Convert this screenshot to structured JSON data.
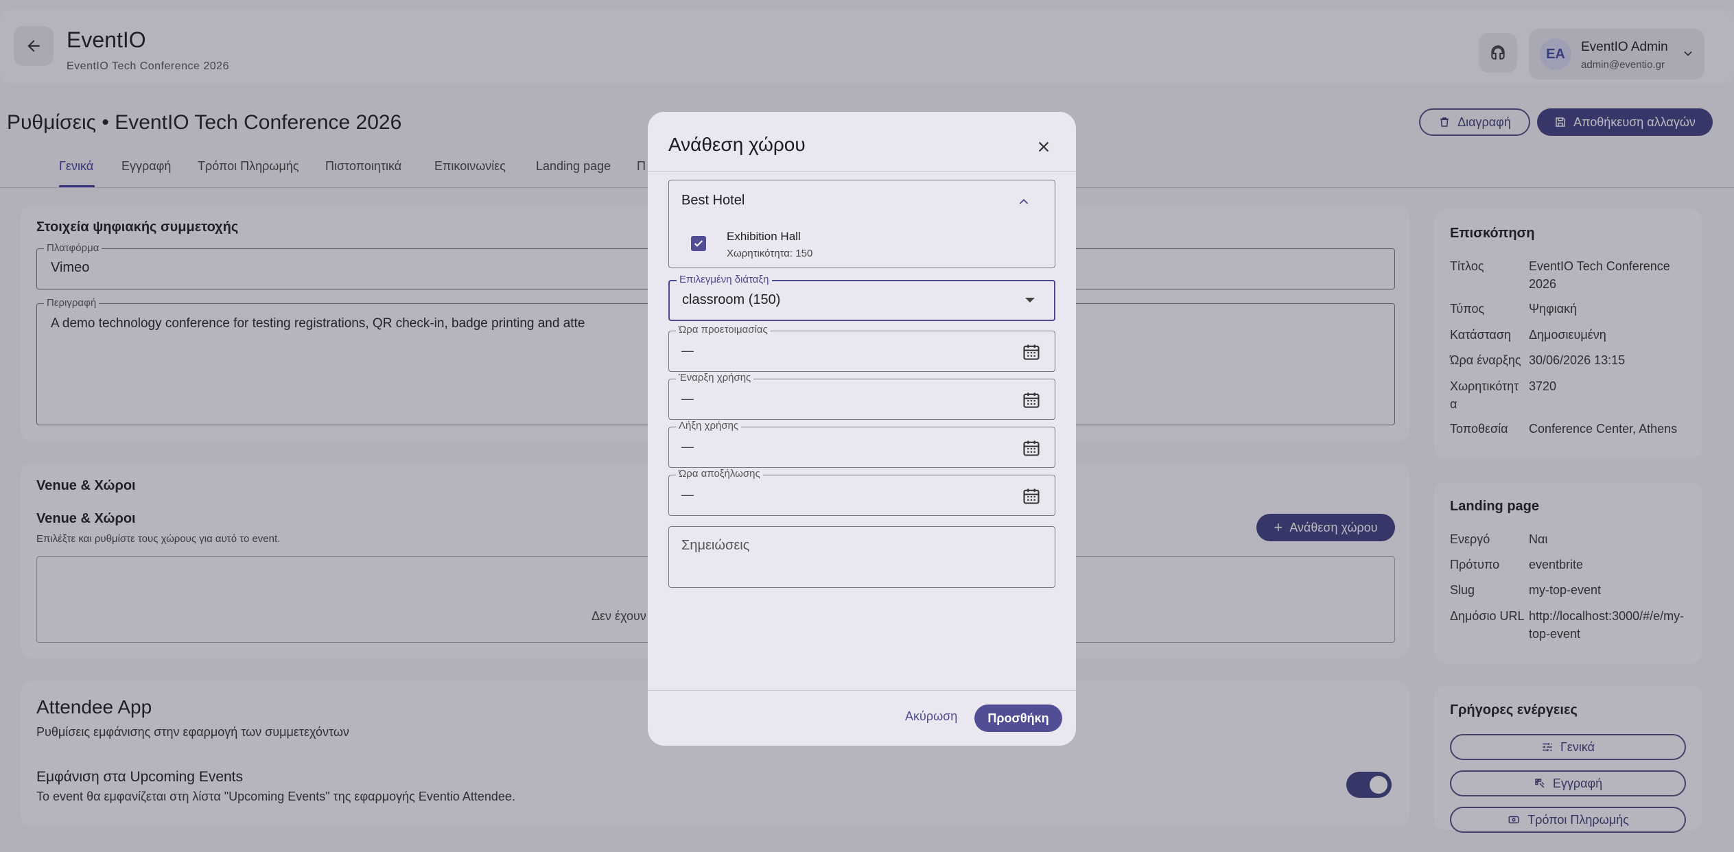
{
  "header": {
    "title": "EventIO",
    "subtitle": "EventIO Tech Conference 2026",
    "user": {
      "initials": "EA",
      "name": "EventIO Admin",
      "email": "admin@eventio.gr"
    }
  },
  "page": {
    "title": "Ρυθμίσεις • EventIO Tech Conference 2026",
    "delete_label": "Διαγραφή",
    "save_label": "Αποθήκευση αλλαγών"
  },
  "tabs": [
    {
      "label": "Γενικά"
    },
    {
      "label": "Εγγραφή"
    },
    {
      "label": "Τρόποι Πληρωμής"
    },
    {
      "label": "Πιστοποιητικά"
    },
    {
      "label": "Επικοινωνίες"
    },
    {
      "label": "Landing page"
    },
    {
      "label": "Π"
    }
  ],
  "digital": {
    "title": "Στοιχεία ψηφιακής συμμετοχής",
    "platform_label": "Πλατφόρμα",
    "platform_value": "Vimeo",
    "desc_label": "Περιγραφή",
    "desc_value": "A demo technology conference for testing registrations, QR check-in, badge printing and atte"
  },
  "venue": {
    "section_title": "Venue & Χώροι",
    "sub_title": "Venue & Χώροι",
    "hint": "Επιλέξτε και ρυθμίστε τους χώρους για αυτό το event.",
    "assign_label": "Ανάθεση χώρου",
    "empty_text": "Δεν έχουν"
  },
  "attendee_app": {
    "title": "Attendee App",
    "subtitle": "Ρυθμίσεις εμφάνισης στην εφαρμογή των συμμετεχόντων",
    "upcoming_title": "Εμφάνιση στα Upcoming Events",
    "upcoming_desc": "Το event θα εμφανίζεται στη λίστα \"Upcoming Events\" της εφαρμογής Eventio Attendee.",
    "upcoming_enabled": true
  },
  "overview": {
    "title": "Επισκόπηση",
    "rows": [
      {
        "k": "Τίτλος",
        "v": "EventIO Tech Conference 2026"
      },
      {
        "k": "Τύπος",
        "v": "Ψηφιακή"
      },
      {
        "k": "Κατάσταση",
        "v": "Δημοσιευμένη"
      },
      {
        "k": "Ώρα έναρξης",
        "v": "30/06/2026 13:15"
      },
      {
        "k": "Χωρητικότητα",
        "v": "3720"
      },
      {
        "k": "Τοποθεσία",
        "v": "Conference Center, Athens"
      }
    ]
  },
  "landing": {
    "title": "Landing page",
    "rows": [
      {
        "k": "Ενεργό",
        "v": "Ναι"
      },
      {
        "k": "Πρότυπο",
        "v": "eventbrite"
      },
      {
        "k": "Slug",
        "v": "my-top-event"
      },
      {
        "k": "Δημόσιο URL",
        "v": "http://localhost:3000/#/e/my-top-event"
      }
    ]
  },
  "quick_actions": {
    "title": "Γρήγορες ενέργειες",
    "buttons": [
      "Γενικά",
      "Εγγραφή",
      "Τρόποι Πληρωμής"
    ]
  },
  "dialog": {
    "title": "Ανάθεση χώρου",
    "venue_name": "Best Hotel",
    "room_name": "Exhibition Hall",
    "room_capacity": "Χωρητικότητα: 150",
    "room_checked": true,
    "layout_label": "Επιλεγμένη διάταξη",
    "layout_value": "classroom (150)",
    "prep_label": "Ώρα προετοιμασίας",
    "start_label": "Έναρξη χρήσης",
    "end_label": "Λήξη χρήσης",
    "teardown_label": "Ώρα αποξήλωσης",
    "empty_value": "—",
    "notes_placeholder": "Σημειώσεις",
    "cancel_label": "Ακύρωση",
    "add_label": "Προσθήκη"
  },
  "colors": {
    "primary": "#514e96",
    "primary_dark": "#3f3f82",
    "surface": "#f9f8fc",
    "dialog_bg": "#ebe7f0"
  }
}
